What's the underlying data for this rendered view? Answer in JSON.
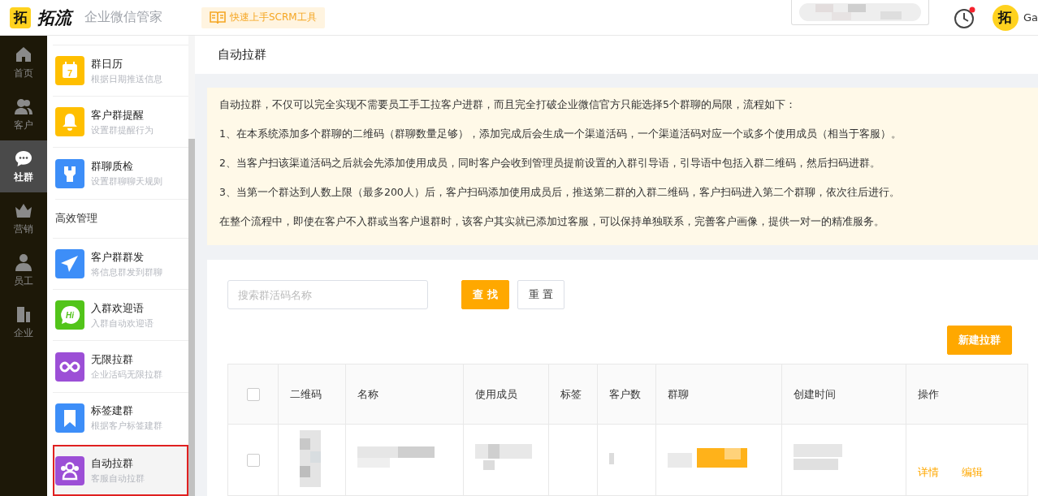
{
  "top_bar": {
    "logo_mark": "拓",
    "brand": "拓流",
    "product": "企业微信管家",
    "guide_button": "快速上手SCRM工具",
    "notification_unread": true,
    "avatar": "拓",
    "user": "Ga"
  },
  "rail": [
    {
      "label": "首页",
      "kind": "home",
      "selected": false
    },
    {
      "label": "客户",
      "kind": "users",
      "selected": false
    },
    {
      "label": "社群",
      "kind": "chat",
      "selected": true
    },
    {
      "label": "营销",
      "kind": "crown",
      "selected": false
    },
    {
      "label": "员工",
      "kind": "staff",
      "selected": false
    },
    {
      "label": "企业",
      "kind": "building",
      "selected": false
    }
  ],
  "submenu": [
    {
      "kind": "calendar",
      "title": "群日历",
      "subtitle": "根据日期推送信息",
      "icon_text": "7",
      "color": "#ffbf00",
      "selected": false
    },
    {
      "kind": "bell",
      "title": "客户群提醒",
      "subtitle": "设置群提醒行为",
      "color": "#ffbf00",
      "selected": false
    },
    {
      "kind": "wrench",
      "title": "群聊质检",
      "subtitle": "设置群聊聊天规则",
      "color": "#3d8ef8",
      "selected": false
    },
    {
      "kind": "section",
      "title": "高效管理"
    },
    {
      "kind": "send",
      "title": "客户群群发",
      "subtitle": "将信息群发到群聊",
      "color": "#3d8ef8",
      "selected": false
    },
    {
      "kind": "bubble",
      "title": "入群欢迎语",
      "subtitle": "入群自动欢迎语",
      "icon_text": "Hi",
      "color": "#52c41a",
      "selected": false
    },
    {
      "kind": "infinity",
      "title": "无限拉群",
      "subtitle": "企业活码无限拉群",
      "color": "#9c4fd6",
      "selected": false
    },
    {
      "kind": "bookmark",
      "title": "标签建群",
      "subtitle": "根据客户标签建群",
      "color": "#3d8ef8",
      "selected": false
    },
    {
      "kind": "people",
      "title": "自动拉群",
      "subtitle": "客服自动拉群",
      "color": "#9c4fd6",
      "selected": true
    }
  ],
  "page_title": "自动拉群",
  "notice": [
    "自动拉群，不仅可以完全实现不需要员工手工拉客户进群，而且完全打破企业微信官方只能选择5个群聊的局限，流程如下：",
    "1、在本系统添加多个群聊的二维码（群聊数量足够），添加完成后会生成一个渠道活码，一个渠道活码对应一个或多个使用成员（相当于客服）。",
    "2、当客户扫该渠道活码之后就会先添加使用成员，同时客户会收到管理员提前设置的入群引导语，引导语中包括入群二维码，然后扫码进群。",
    "3、当第一个群达到人数上限（最多200人）后，客户扫码添加使用成员后，推送第二群的入群二维码，客户扫码进入第二个群聊，依次往后进行。",
    "在整个流程中，即使在客户不入群或当客户退群时，该客户其实就已添加过客服，可以保持单独联系，完善客户画像，提供一对一的精准服务。"
  ],
  "search": {
    "placeholder": "搜索群活码名称"
  },
  "search_button": "查 找",
  "reset_button": "重 置",
  "new_button": "新建拉群",
  "table": {
    "header_checked": false,
    "columns": [
      "二维码",
      "名称",
      "使用成员",
      "标签",
      "客户数",
      "群聊",
      "创建时间",
      "操作"
    ],
    "rows": [
      {
        "checked": false,
        "actions": [
          "详情",
          "编辑"
        ]
      }
    ]
  }
}
